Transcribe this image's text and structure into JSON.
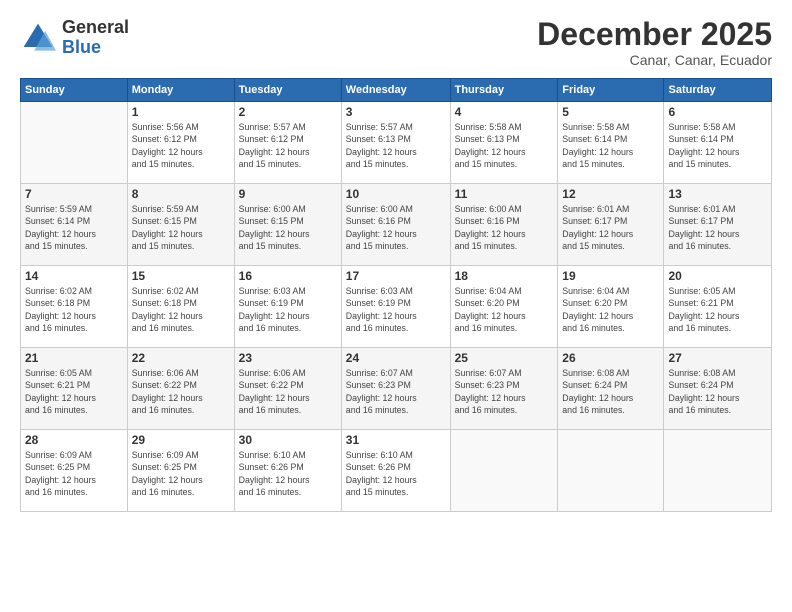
{
  "header": {
    "logo_line1": "General",
    "logo_line2": "Blue",
    "month": "December 2025",
    "location": "Canar, Canar, Ecuador"
  },
  "days_of_week": [
    "Sunday",
    "Monday",
    "Tuesday",
    "Wednesday",
    "Thursday",
    "Friday",
    "Saturday"
  ],
  "weeks": [
    [
      {
        "num": "",
        "info": ""
      },
      {
        "num": "1",
        "info": "Sunrise: 5:56 AM\nSunset: 6:12 PM\nDaylight: 12 hours\nand 15 minutes."
      },
      {
        "num": "2",
        "info": "Sunrise: 5:57 AM\nSunset: 6:12 PM\nDaylight: 12 hours\nand 15 minutes."
      },
      {
        "num": "3",
        "info": "Sunrise: 5:57 AM\nSunset: 6:13 PM\nDaylight: 12 hours\nand 15 minutes."
      },
      {
        "num": "4",
        "info": "Sunrise: 5:58 AM\nSunset: 6:13 PM\nDaylight: 12 hours\nand 15 minutes."
      },
      {
        "num": "5",
        "info": "Sunrise: 5:58 AM\nSunset: 6:14 PM\nDaylight: 12 hours\nand 15 minutes."
      },
      {
        "num": "6",
        "info": "Sunrise: 5:58 AM\nSunset: 6:14 PM\nDaylight: 12 hours\nand 15 minutes."
      }
    ],
    [
      {
        "num": "7",
        "info": "Sunrise: 5:59 AM\nSunset: 6:14 PM\nDaylight: 12 hours\nand 15 minutes."
      },
      {
        "num": "8",
        "info": "Sunrise: 5:59 AM\nSunset: 6:15 PM\nDaylight: 12 hours\nand 15 minutes."
      },
      {
        "num": "9",
        "info": "Sunrise: 6:00 AM\nSunset: 6:15 PM\nDaylight: 12 hours\nand 15 minutes."
      },
      {
        "num": "10",
        "info": "Sunrise: 6:00 AM\nSunset: 6:16 PM\nDaylight: 12 hours\nand 15 minutes."
      },
      {
        "num": "11",
        "info": "Sunrise: 6:00 AM\nSunset: 6:16 PM\nDaylight: 12 hours\nand 15 minutes."
      },
      {
        "num": "12",
        "info": "Sunrise: 6:01 AM\nSunset: 6:17 PM\nDaylight: 12 hours\nand 15 minutes."
      },
      {
        "num": "13",
        "info": "Sunrise: 6:01 AM\nSunset: 6:17 PM\nDaylight: 12 hours\nand 16 minutes."
      }
    ],
    [
      {
        "num": "14",
        "info": "Sunrise: 6:02 AM\nSunset: 6:18 PM\nDaylight: 12 hours\nand 16 minutes."
      },
      {
        "num": "15",
        "info": "Sunrise: 6:02 AM\nSunset: 6:18 PM\nDaylight: 12 hours\nand 16 minutes."
      },
      {
        "num": "16",
        "info": "Sunrise: 6:03 AM\nSunset: 6:19 PM\nDaylight: 12 hours\nand 16 minutes."
      },
      {
        "num": "17",
        "info": "Sunrise: 6:03 AM\nSunset: 6:19 PM\nDaylight: 12 hours\nand 16 minutes."
      },
      {
        "num": "18",
        "info": "Sunrise: 6:04 AM\nSunset: 6:20 PM\nDaylight: 12 hours\nand 16 minutes."
      },
      {
        "num": "19",
        "info": "Sunrise: 6:04 AM\nSunset: 6:20 PM\nDaylight: 12 hours\nand 16 minutes."
      },
      {
        "num": "20",
        "info": "Sunrise: 6:05 AM\nSunset: 6:21 PM\nDaylight: 12 hours\nand 16 minutes."
      }
    ],
    [
      {
        "num": "21",
        "info": "Sunrise: 6:05 AM\nSunset: 6:21 PM\nDaylight: 12 hours\nand 16 minutes."
      },
      {
        "num": "22",
        "info": "Sunrise: 6:06 AM\nSunset: 6:22 PM\nDaylight: 12 hours\nand 16 minutes."
      },
      {
        "num": "23",
        "info": "Sunrise: 6:06 AM\nSunset: 6:22 PM\nDaylight: 12 hours\nand 16 minutes."
      },
      {
        "num": "24",
        "info": "Sunrise: 6:07 AM\nSunset: 6:23 PM\nDaylight: 12 hours\nand 16 minutes."
      },
      {
        "num": "25",
        "info": "Sunrise: 6:07 AM\nSunset: 6:23 PM\nDaylight: 12 hours\nand 16 minutes."
      },
      {
        "num": "26",
        "info": "Sunrise: 6:08 AM\nSunset: 6:24 PM\nDaylight: 12 hours\nand 16 minutes."
      },
      {
        "num": "27",
        "info": "Sunrise: 6:08 AM\nSunset: 6:24 PM\nDaylight: 12 hours\nand 16 minutes."
      }
    ],
    [
      {
        "num": "28",
        "info": "Sunrise: 6:09 AM\nSunset: 6:25 PM\nDaylight: 12 hours\nand 16 minutes."
      },
      {
        "num": "29",
        "info": "Sunrise: 6:09 AM\nSunset: 6:25 PM\nDaylight: 12 hours\nand 16 minutes."
      },
      {
        "num": "30",
        "info": "Sunrise: 6:10 AM\nSunset: 6:26 PM\nDaylight: 12 hours\nand 16 minutes."
      },
      {
        "num": "31",
        "info": "Sunrise: 6:10 AM\nSunset: 6:26 PM\nDaylight: 12 hours\nand 15 minutes."
      },
      {
        "num": "",
        "info": ""
      },
      {
        "num": "",
        "info": ""
      },
      {
        "num": "",
        "info": ""
      }
    ]
  ]
}
